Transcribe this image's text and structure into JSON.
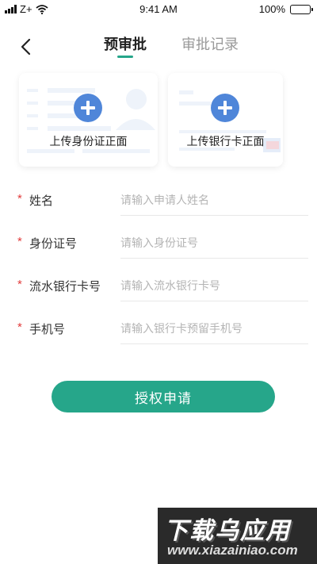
{
  "status_bar": {
    "carrier": "Z+",
    "time": "9:41 AM",
    "battery": "100%",
    "battery_level": 1.0
  },
  "nav": {
    "tabs": [
      {
        "label": "预审批",
        "active": true
      },
      {
        "label": "审批记录",
        "active": false
      }
    ],
    "accent_color": "#26a68a"
  },
  "upload": {
    "id_card_label": "上传身份证正面",
    "bank_card_label": "上传银行卡正面",
    "plus_color": "#4f86d9"
  },
  "form": {
    "fields": [
      {
        "label": "姓名",
        "placeholder": "请输入申请人姓名",
        "value": ""
      },
      {
        "label": "身份证号",
        "placeholder": "请输入身份证号",
        "value": ""
      },
      {
        "label": "流水银行卡号",
        "placeholder": "请输入流水银行卡号",
        "value": ""
      },
      {
        "label": "手机号",
        "placeholder": "请输入银行卡预留手机号",
        "value": ""
      }
    ],
    "required_mark": "*",
    "required_color": "#e23b3b"
  },
  "submit": {
    "label": "授权申请"
  },
  "watermark": {
    "title": "下载乌应用",
    "url": "www.xiazainiao.com"
  }
}
